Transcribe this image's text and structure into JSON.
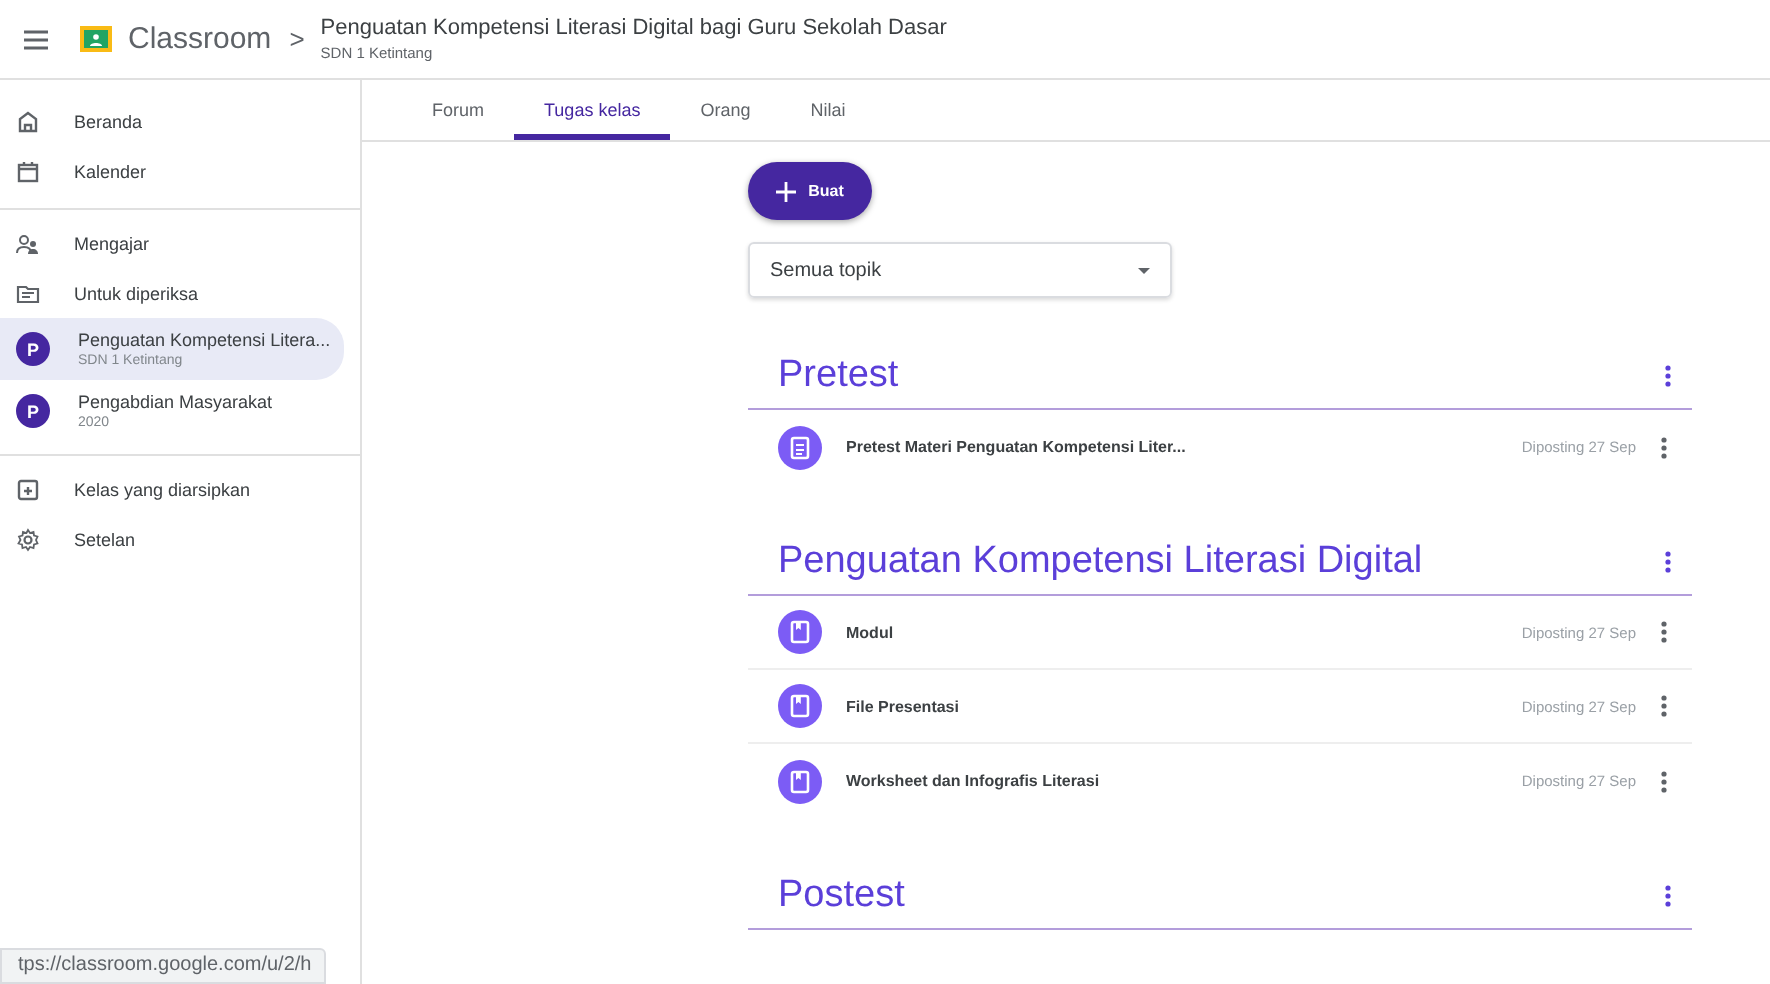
{
  "header": {
    "app_name": "Classroom",
    "separator": ">",
    "class_title": "Penguatan Kompetensi Literasi Digital bagi Guru Sekolah Dasar",
    "class_subtitle": "SDN 1 Ketintang"
  },
  "sidebar": {
    "groups": [
      {
        "items": [
          {
            "kind": "nav",
            "label": "Beranda",
            "selected": false
          },
          {
            "kind": "nav",
            "label": "Kalender",
            "selected": false
          }
        ]
      },
      {
        "items": [
          {
            "kind": "nav",
            "label": "Mengajar",
            "selected": false
          },
          {
            "kind": "nav",
            "label": "Untuk diperiksa",
            "selected": false
          },
          {
            "kind": "class",
            "avatar": "P",
            "label": "Penguatan Kompetensi Litera...",
            "sublabel": "SDN 1 Ketintang",
            "selected": true
          },
          {
            "kind": "class",
            "avatar": "P",
            "label": "Pengabdian Masyarakat",
            "sublabel": "2020",
            "selected": false
          }
        ]
      },
      {
        "items": [
          {
            "kind": "nav",
            "label": "Kelas yang diarsipkan",
            "selected": false
          },
          {
            "kind": "nav",
            "label": "Setelan",
            "selected": false
          }
        ]
      }
    ]
  },
  "tabs": [
    {
      "label": "Forum",
      "selected": false
    },
    {
      "label": "Tugas kelas",
      "selected": true
    },
    {
      "label": "Orang",
      "selected": false
    },
    {
      "label": "Nilai",
      "selected": false
    }
  ],
  "create_button": "Buat",
  "topic_filter": {
    "value": "Semua topik"
  },
  "topics": [
    {
      "title": "Pretest",
      "items": [
        {
          "kind": "quiz",
          "title": "Pretest Materi Penguatan Kompetensi Liter...",
          "posted": "Diposting 27 Sep"
        }
      ]
    },
    {
      "title": "Penguatan Kompetensi Literasi Digital",
      "items": [
        {
          "kind": "material",
          "title": "Modul",
          "posted": "Diposting 27 Sep"
        },
        {
          "kind": "material",
          "title": "File Presentasi",
          "posted": "Diposting 27 Sep"
        },
        {
          "kind": "material",
          "title": "Worksheet dan Infografis Literasi",
          "posted": "Diposting 27 Sep"
        }
      ]
    },
    {
      "title": "Postest"
    }
  ],
  "status_url": "tps://classroom.google.com/u/2/h"
}
